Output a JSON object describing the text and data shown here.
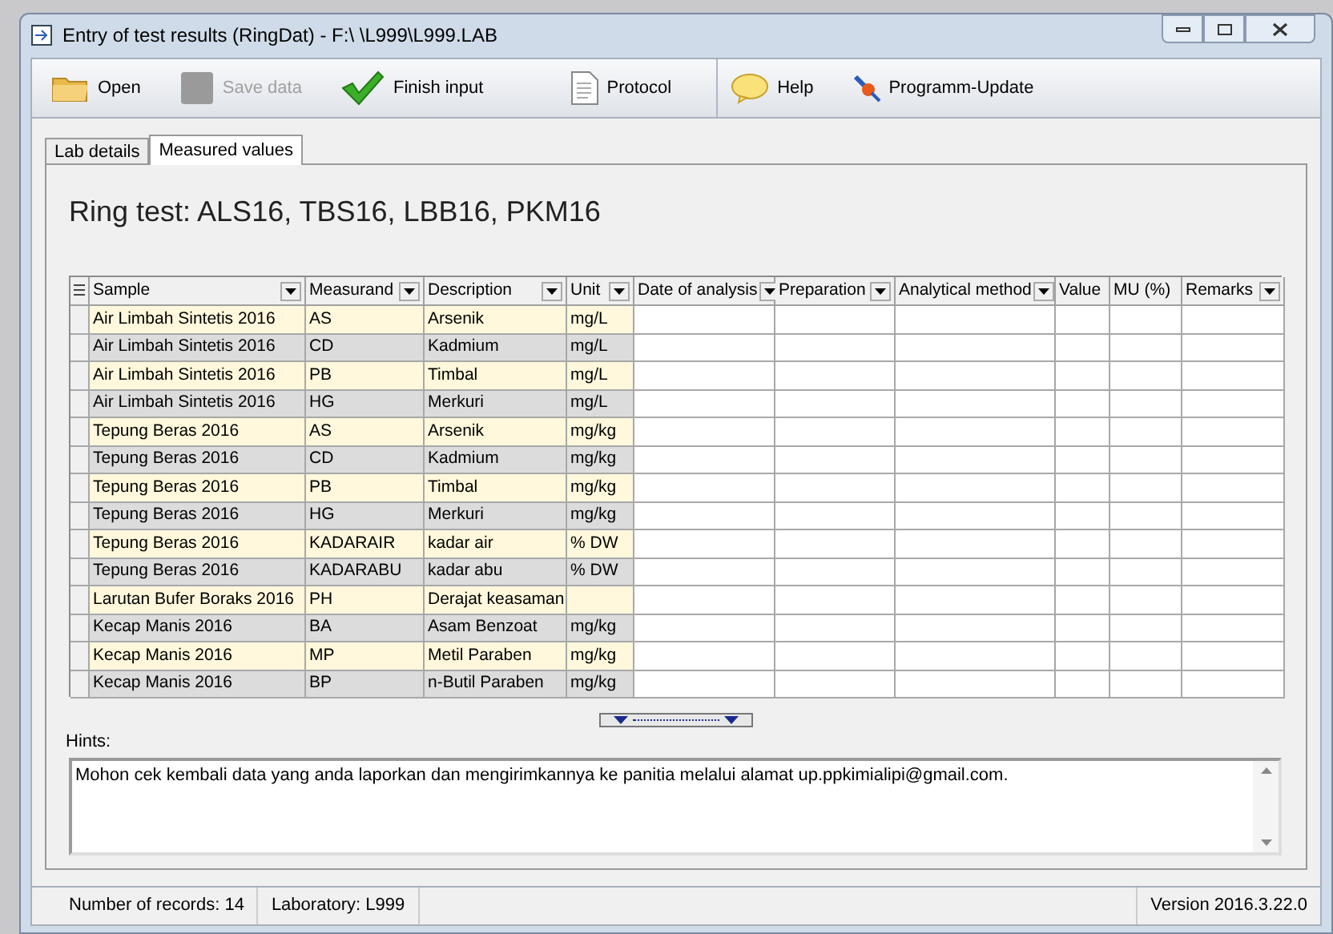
{
  "window": {
    "title": "Entry of test results (RingDat) - F:\\ \\L999\\L999.LAB"
  },
  "toolbar": [
    {
      "kind": "folder",
      "label": "Open",
      "disabled": false
    },
    {
      "kind": "save",
      "label": "Save data",
      "disabled": true
    },
    {
      "kind": "check",
      "label": "Finish input",
      "disabled": false
    },
    {
      "kind": "document",
      "label": "Protocol",
      "disabled": false
    },
    {
      "kind": "help",
      "label": "Help",
      "disabled": false
    },
    {
      "kind": "update",
      "label": "Programm-Update",
      "disabled": false
    }
  ],
  "tabs": [
    {
      "label": "Lab details",
      "selected": false
    },
    {
      "label": "Measured values",
      "selected": true
    }
  ],
  "heading": "Ring test: ALS16, TBS16, LBB16, PKM16",
  "table": {
    "columns": [
      {
        "label": "Sample",
        "filter": true
      },
      {
        "label": "Measurand",
        "filter": true
      },
      {
        "label": "Description",
        "filter": true
      },
      {
        "label": "Unit",
        "filter": true
      },
      {
        "label": "Date of analysis",
        "filter": true
      },
      {
        "label": "Preparation",
        "filter": true
      },
      {
        "label": "Analytical method",
        "filter": true
      },
      {
        "label": "Value",
        "filter": false
      },
      {
        "label": "MU (%)",
        "filter": false
      },
      {
        "label": "Remarks",
        "filter": true
      }
    ],
    "rows": [
      [
        "Air Limbah Sintetis 2016",
        "AS",
        "Arsenik",
        "mg/L"
      ],
      [
        "Air Limbah Sintetis 2016",
        "CD",
        "Kadmium",
        "mg/L"
      ],
      [
        "Air Limbah Sintetis 2016",
        "PB",
        "Timbal",
        "mg/L"
      ],
      [
        "Air Limbah Sintetis 2016",
        "HG",
        "Merkuri",
        "mg/L"
      ],
      [
        "Tepung Beras 2016",
        "AS",
        "Arsenik",
        "mg/kg"
      ],
      [
        "Tepung Beras 2016",
        "CD",
        "Kadmium",
        "mg/kg"
      ],
      [
        "Tepung Beras 2016",
        "PB",
        "Timbal",
        "mg/kg"
      ],
      [
        "Tepung Beras 2016",
        "HG",
        "Merkuri",
        "mg/kg"
      ],
      [
        "Tepung Beras 2016",
        "KADARAIR",
        "kadar air",
        "% DW"
      ],
      [
        "Tepung Beras 2016",
        "KADARABU",
        "kadar abu",
        "% DW"
      ],
      [
        "Larutan Bufer Boraks 2016",
        "PH",
        "Derajat keasaman",
        ""
      ],
      [
        "Kecap Manis 2016",
        "BA",
        "Asam Benzoat",
        "mg/kg"
      ],
      [
        "Kecap Manis 2016",
        "MP",
        "Metil Paraben",
        "mg/kg"
      ],
      [
        "Kecap Manis 2016",
        "BP",
        "n-Butil Paraben",
        "mg/kg"
      ]
    ]
  },
  "hints": {
    "label": "Hints:",
    "value": "Mohon cek kembali data  yang anda laporkan dan  mengirimkannya ke panitia  melalui  alamat  up.ppkimialipi@gmail.com."
  },
  "status_bar": [
    "Number of records: 14",
    "Laboratory: L999",
    "Version 2016.3.22.0"
  ]
}
